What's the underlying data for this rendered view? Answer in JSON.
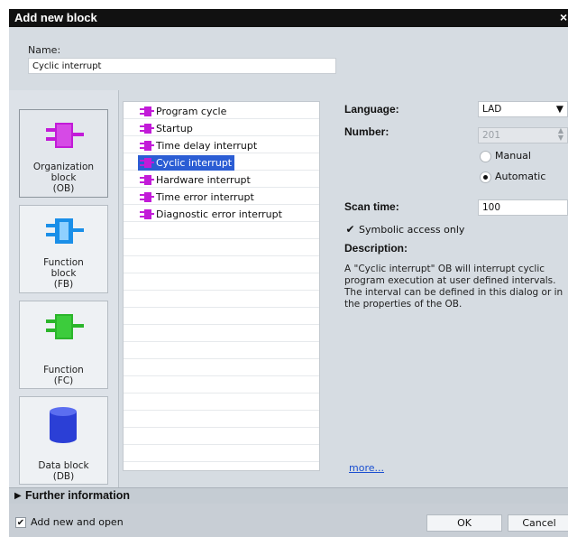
{
  "dialog": {
    "title": "Add new block",
    "close_glyph": "×",
    "name_label": "Name:",
    "name_value": "Cyclic interrupt"
  },
  "tiles": [
    {
      "label": "Organization\nblock\n(OB)",
      "icon": "organization-block-icon",
      "color": "#c21bd8",
      "selected": true
    },
    {
      "label": "Function\nblock\n(FB)",
      "icon": "function-block-icon",
      "color": "#1a8fe8",
      "selected": false
    },
    {
      "label": "Function\n(FC)",
      "icon": "function-icon",
      "color": "#2bb52b",
      "selected": false
    },
    {
      "label": "Data block\n(DB)",
      "icon": "data-block-icon",
      "color": "#2b3fd6",
      "selected": false
    }
  ],
  "ob_types": [
    {
      "label": "Program cycle",
      "selected": false
    },
    {
      "label": "Startup",
      "selected": false
    },
    {
      "label": "Time delay interrupt",
      "selected": false
    },
    {
      "label": "Cyclic interrupt",
      "selected": true
    },
    {
      "label": "Hardware interrupt",
      "selected": false
    },
    {
      "label": "Time error interrupt",
      "selected": false
    },
    {
      "label": "Diagnostic error interrupt",
      "selected": false
    }
  ],
  "props": {
    "language_label": "Language:",
    "language_value": "LAD",
    "number_label": "Number:",
    "number_value": "201",
    "manual_label": "Manual",
    "automatic_label": "Automatic",
    "number_mode": "Automatic",
    "scan_time_label": "Scan time:",
    "scan_time_value": "100",
    "symbolic_label": "Symbolic access only",
    "symbolic_checked": true,
    "description_label": "Description:",
    "description_lines": [
      "A \"Cyclic interrupt\" OB will interrupt cyclic",
      "program execution at user defined intervals.",
      "The interval can be defined in this dialog or in",
      "the properties of the OB."
    ],
    "more_link": "more..."
  },
  "further": {
    "label": "Further information",
    "arrow": "▶"
  },
  "footer": {
    "add_new_label": "Add new and open",
    "add_new_checked": true,
    "ok_label": "OK",
    "cancel_label": "Cancel"
  },
  "colors": {
    "selection": "#2b5dd4",
    "ob_icon": "#c21bd8",
    "link": "#1a4fd0"
  }
}
